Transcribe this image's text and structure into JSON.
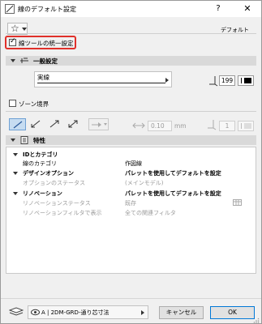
{
  "window": {
    "title": "線のデフォルト設定",
    "help_label": "?",
    "close_label": "✕"
  },
  "header": {
    "favorites_icon": "star-icon",
    "default_label": "デフォルト"
  },
  "unify": {
    "label": "線ツールの統一設定",
    "checked": true
  },
  "general_section": {
    "label": "一般設定"
  },
  "line_type": {
    "name": "実線"
  },
  "pen": {
    "number": "199",
    "color": "#000000"
  },
  "zone_boundary": {
    "label": "ゾーン境界",
    "checked": false
  },
  "arrow_options": {
    "length_value": "0.10",
    "length_unit": "mm",
    "pen_value": "1"
  },
  "properties_section": {
    "label": "特性"
  },
  "property_rows": [
    {
      "label": "IDとカテゴリ",
      "value": "",
      "group": true,
      "disabled": false
    },
    {
      "label": "線のカテゴリ",
      "value": "作図線",
      "group": false,
      "disabled": false
    },
    {
      "label": "デザインオプション",
      "value": "パレットを使用してデフォルトを設定",
      "group": true,
      "disabled": false
    },
    {
      "label": "オプションのステータス",
      "value": "(メインモデル)",
      "group": false,
      "disabled": true
    },
    {
      "label": "リノベーション",
      "value": "パレットを使用してデフォルトを設定",
      "group": true,
      "disabled": false
    },
    {
      "label": "リノベーションステータス",
      "value": "既存",
      "group": false,
      "disabled": true
    },
    {
      "label": "リノベーションフィルタで表示",
      "value": "全ての関連フィルタ",
      "group": false,
      "disabled": true
    }
  ],
  "footer": {
    "layer_name": "A | 2DM-GRD-通り芯寸法",
    "cancel_label": "キャンセル",
    "ok_label": "OK"
  }
}
